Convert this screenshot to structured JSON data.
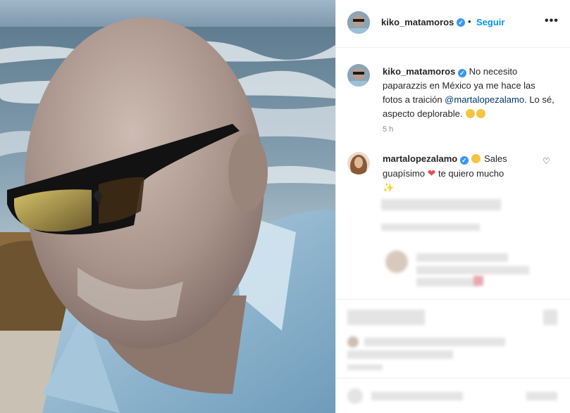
{
  "post": {
    "username": "kiko_matamoros",
    "follow_label": "Seguir",
    "more_label": "•••",
    "separator": "•"
  },
  "caption": {
    "username": "kiko_matamoros",
    "text_1": "No necesito paparazzis en México ya me hace las fotos a traición",
    "mention": "@martalopezalamo",
    "text_2": ". Lo sé, aspecto deplorable.",
    "time": "5 h"
  },
  "comments": [
    {
      "username": "martalopezalamo",
      "text_1": "Sales guapísimo",
      "text_2": "te quiero mucho"
    }
  ],
  "colors": {
    "accent": "#0095f6",
    "verified": "#3897f0",
    "heart_red": "#ed4956",
    "text": "#262626",
    "muted": "#8e8e8e"
  },
  "icons": {
    "verified": "verified-badge-icon",
    "like": "heart-outline-icon",
    "red_heart": "red-heart-emoji",
    "sparkle": "sparkles-emoji"
  }
}
